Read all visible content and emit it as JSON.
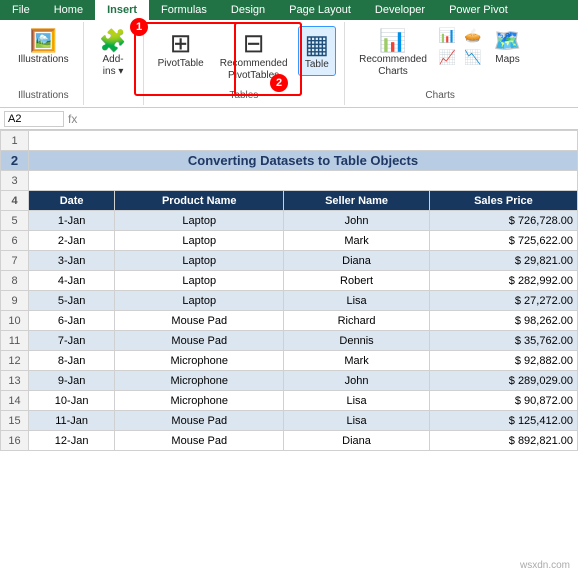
{
  "tabs": [
    {
      "label": "File",
      "active": false
    },
    {
      "label": "Home",
      "active": false
    },
    {
      "label": "Insert",
      "active": true
    },
    {
      "label": "Formulas",
      "active": false
    },
    {
      "label": "Design",
      "active": false
    },
    {
      "label": "Page Layout",
      "active": false
    },
    {
      "label": "Developer",
      "active": false
    },
    {
      "label": "Power Pivot",
      "active": false
    }
  ],
  "groups": [
    {
      "name": "Illustrations",
      "label": "Illustrations",
      "buttons": [
        {
          "icon": "🖼",
          "label": "Illustrations"
        }
      ]
    },
    {
      "name": "Add-ins",
      "label": "",
      "buttons": [
        {
          "icon": "🔌",
          "label": "Add-\nins ▾"
        }
      ]
    },
    {
      "name": "Tables",
      "label": "Tables",
      "buttons": [
        {
          "icon": "⊞",
          "label": "PivotTable"
        },
        {
          "icon": "⊞",
          "label": "Recommended\nPivotTables"
        },
        {
          "icon": "▦",
          "label": "Table"
        }
      ]
    },
    {
      "name": "Charts",
      "label": "Charts",
      "buttons": [
        {
          "icon": "📊",
          "label": "Recommended\nCharts"
        },
        {
          "icon": "📈",
          "label": ""
        },
        {
          "icon": "📉",
          "label": ""
        },
        {
          "icon": "📊",
          "label": ""
        },
        {
          "icon": "🗺",
          "label": "Maps"
        }
      ]
    }
  ],
  "namebox": "A2",
  "title": "Converting Datasets to Table Objects",
  "columns": [
    "Date",
    "Product Name",
    "Seller Name",
    "Sales Price"
  ],
  "rows": [
    {
      "date": "1-Jan",
      "product": "Laptop",
      "seller": "John",
      "price": "$ 726,728.00"
    },
    {
      "date": "2-Jan",
      "product": "Laptop",
      "seller": "Mark",
      "price": "$ 725,622.00"
    },
    {
      "date": "3-Jan",
      "product": "Laptop",
      "seller": "Diana",
      "price": "$ 29,821.00"
    },
    {
      "date": "4-Jan",
      "product": "Laptop",
      "seller": "Robert",
      "price": "$ 282,992.00"
    },
    {
      "date": "5-Jan",
      "product": "Laptop",
      "seller": "Lisa",
      "price": "$ 27,272.00"
    },
    {
      "date": "6-Jan",
      "product": "Mouse Pad",
      "seller": "Richard",
      "price": "$ 98,262.00"
    },
    {
      "date": "7-Jan",
      "product": "Mouse Pad",
      "seller": "Dennis",
      "price": "$ 35,762.00"
    },
    {
      "date": "8-Jan",
      "product": "Microphone",
      "seller": "Mark",
      "price": "$ 92,882.00"
    },
    {
      "date": "9-Jan",
      "product": "Microphone",
      "seller": "John",
      "price": "$ 289,029.00"
    },
    {
      "date": "10-Jan",
      "product": "Microphone",
      "seller": "Lisa",
      "price": "$ 90,872.00"
    },
    {
      "date": "11-Jan",
      "product": "Mouse Pad",
      "seller": "Lisa",
      "price": "$ 125,412.00"
    },
    {
      "date": "12-Jan",
      "product": "Mouse Pad",
      "seller": "Diana",
      "price": "$ 892,821.00"
    }
  ],
  "row_numbers_start": 1,
  "badge1": "1",
  "badge2": "2",
  "watermark": "wsxdn.com"
}
